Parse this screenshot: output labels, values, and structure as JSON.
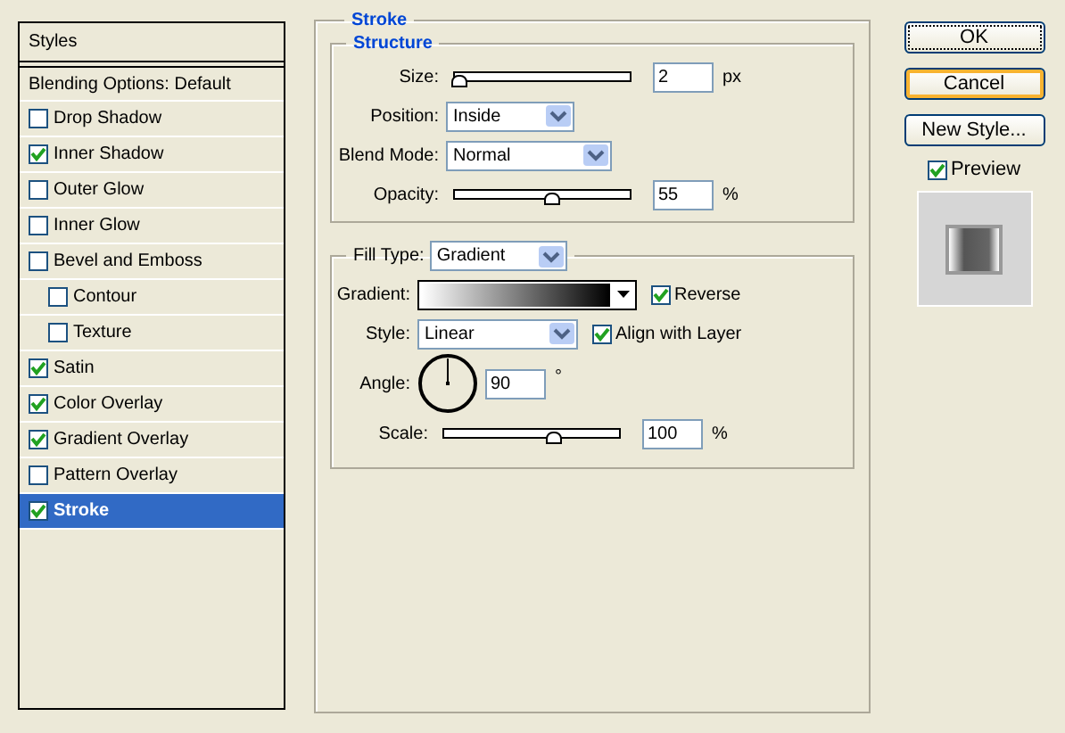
{
  "sidebar": {
    "title": "Styles",
    "header": "Blending Options: Default",
    "items": [
      {
        "label": "Drop Shadow",
        "checked": false,
        "selected": false
      },
      {
        "label": "Inner Shadow",
        "checked": true,
        "selected": false
      },
      {
        "label": "Outer Glow",
        "checked": false,
        "selected": false
      },
      {
        "label": "Inner Glow",
        "checked": false,
        "selected": false
      },
      {
        "label": "Bevel and Emboss",
        "checked": false,
        "selected": false,
        "children": [
          {
            "label": "Contour",
            "checked": false,
            "selected": false
          },
          {
            "label": "Texture",
            "checked": false,
            "selected": false
          }
        ]
      },
      {
        "label": "Satin",
        "checked": true,
        "selected": false
      },
      {
        "label": "Color Overlay",
        "checked": true,
        "selected": false
      },
      {
        "label": "Gradient Overlay",
        "checked": true,
        "selected": false
      },
      {
        "label": "Pattern Overlay",
        "checked": false,
        "selected": false
      },
      {
        "label": "Stroke",
        "checked": true,
        "selected": true
      }
    ]
  },
  "stroke": {
    "title": "Stroke",
    "structure": {
      "title": "Structure",
      "size": {
        "label": "Size:",
        "level": 0.02,
        "value": "2",
        "unit": "px"
      },
      "position": {
        "label": "Position:",
        "value": "Inside"
      },
      "blend_mode": {
        "label": "Blend Mode:",
        "value": "Normal"
      },
      "opacity": {
        "label": "Opacity:",
        "level": 0.55,
        "value": "55",
        "unit": "%"
      }
    },
    "fill": {
      "label": "Fill Type:",
      "value": "Gradient",
      "gradient": {
        "label": "Gradient:"
      },
      "reverse": {
        "label": "Reverse",
        "checked": true
      },
      "style": {
        "label": "Style:",
        "value": "Linear"
      },
      "align": {
        "label": "Align with Layer",
        "checked": true
      },
      "angle": {
        "label": "Angle:",
        "value": "90",
        "unit": "°"
      },
      "scale": {
        "label": "Scale:",
        "level": 0.62,
        "value": "100",
        "unit": "%"
      }
    }
  },
  "buttons": [
    {
      "label": "OK",
      "focused": true,
      "hot": false
    },
    {
      "label": "Cancel",
      "focused": false,
      "hot": true
    },
    {
      "label": "New Style...",
      "focused": false,
      "hot": false
    }
  ],
  "preview": {
    "label": "Preview",
    "checked": true
  }
}
